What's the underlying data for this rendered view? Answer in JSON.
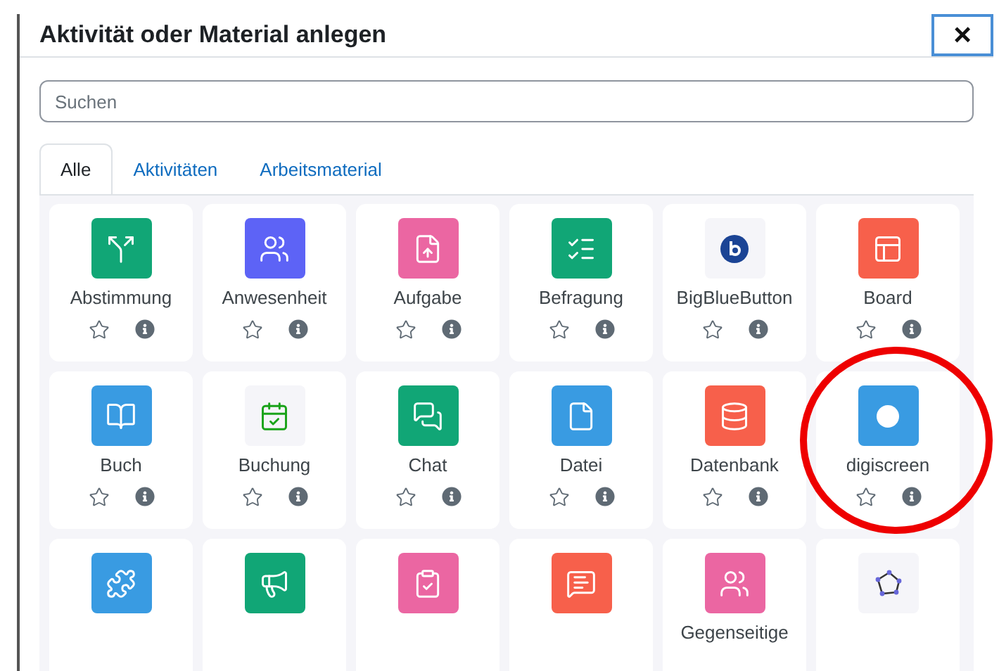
{
  "dialog": {
    "title": "Aktivität oder Material anlegen",
    "close": "×"
  },
  "search": {
    "placeholder": "Suchen"
  },
  "tabs": [
    {
      "label": "Alle",
      "selected": true
    },
    {
      "label": "Aktivitäten",
      "selected": false
    },
    {
      "label": "Arbeitsmaterial",
      "selected": false
    }
  ],
  "items": [
    {
      "label": "Abstimmung",
      "color": "#11a676",
      "highlighted": false
    },
    {
      "label": "Anwesenheit",
      "color": "#5d63f6",
      "highlighted": false
    },
    {
      "label": "Aufgabe",
      "color": "#eb66a2",
      "highlighted": false
    },
    {
      "label": "Befragung",
      "color": "#11a676",
      "highlighted": false
    },
    {
      "label": "BigBlueButton",
      "color": "#f5f5f9",
      "highlighted": false
    },
    {
      "label": "Board",
      "color": "#f7604b",
      "highlighted": false
    },
    {
      "label": "Buch",
      "color": "#399be2",
      "highlighted": false
    },
    {
      "label": "Buchung",
      "color": "#f5f5f9",
      "highlighted": false
    },
    {
      "label": "Chat",
      "color": "#11a676",
      "highlighted": false
    },
    {
      "label": "Datei",
      "color": "#399be2",
      "highlighted": false
    },
    {
      "label": "Datenbank",
      "color": "#f7604b",
      "highlighted": false
    },
    {
      "label": "digiscreen",
      "color": "#399be2",
      "highlighted": true
    },
    {
      "color": "#399be2",
      "highlighted": false
    },
    {
      "color": "#11a676",
      "highlighted": false
    },
    {
      "color": "#eb66a2",
      "highlighted": false
    },
    {
      "color": "#f7604b",
      "highlighted": false
    },
    {
      "label": "Gegenseitige",
      "color": "#eb66a2",
      "highlighted": false
    },
    {
      "color": "#f5f5f9",
      "highlighted": false
    }
  ]
}
